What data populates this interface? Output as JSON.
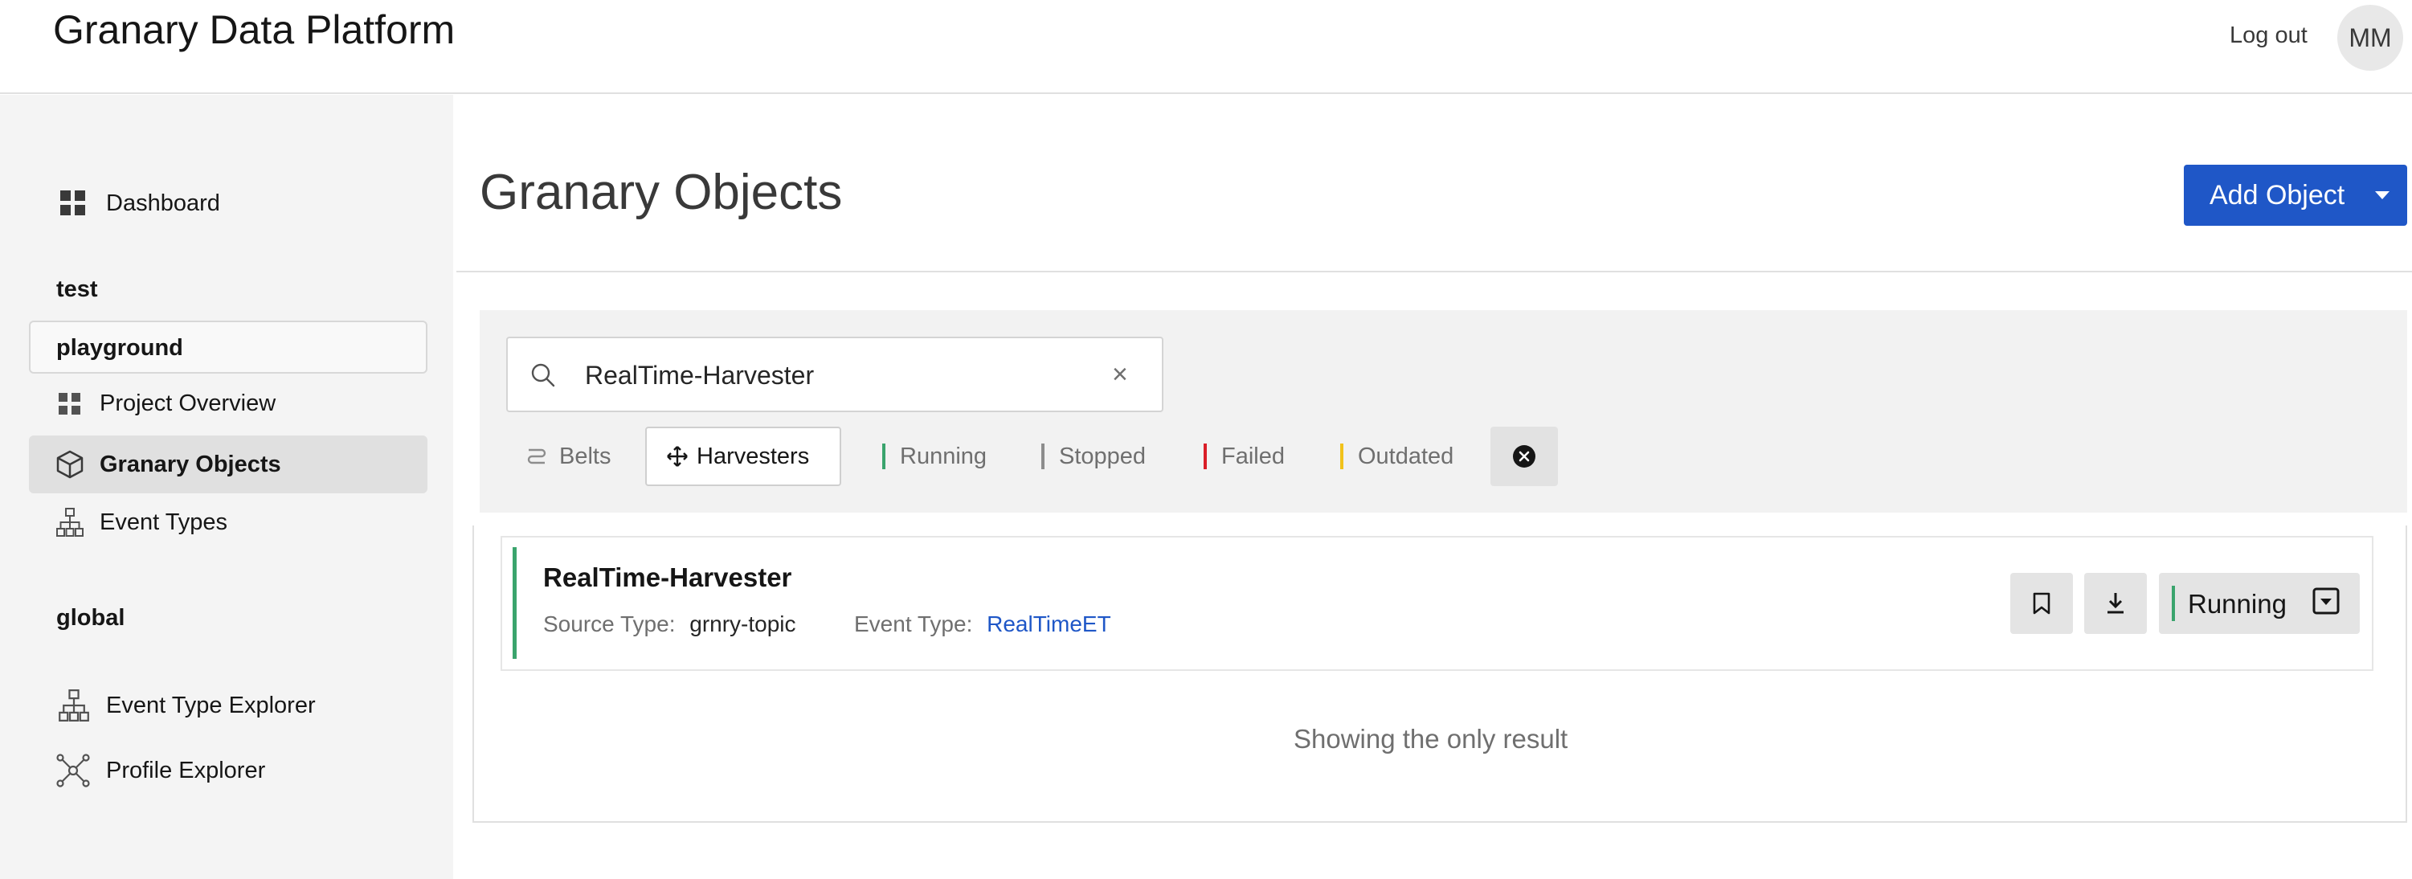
{
  "header": {
    "app_title": "Granary Data Platform",
    "logout_label": "Log out",
    "avatar_initials": "MM"
  },
  "sidebar": {
    "dashboard_label": "Dashboard",
    "test_heading": "test",
    "project_label": "playground",
    "items": [
      {
        "label": "Project Overview",
        "icon": "grid-icon"
      },
      {
        "label": "Granary Objects",
        "icon": "cube-icon",
        "active": true
      },
      {
        "label": "Event Types",
        "icon": "hierarchy-icon"
      }
    ],
    "global_heading": "global",
    "global_items": [
      {
        "label": "Event Type Explorer",
        "icon": "hierarchy-icon"
      },
      {
        "label": "Profile Explorer",
        "icon": "network-icon"
      }
    ]
  },
  "main": {
    "page_title": "Granary Objects",
    "add_button_label": "Add Object",
    "search": {
      "value": "RealTime-Harvester"
    },
    "filters": {
      "belts_label": "Belts",
      "harvesters_label": "Harvesters",
      "running_label": "Running",
      "stopped_label": "Stopped",
      "failed_label": "Failed",
      "outdated_label": "Outdated"
    },
    "result": {
      "name": "RealTime-Harvester",
      "source_type_key": "Source Type:",
      "source_type_value": "grnry-topic",
      "event_type_key": "Event Type:",
      "event_type_value": "RealTimeET",
      "status_label": "Running"
    },
    "result_count_text": "Showing the only result"
  },
  "colors": {
    "accent_blue": "#1f57c7",
    "running_green": "#3aa46d",
    "stopped_gray": "#8d8d8d",
    "failed_red": "#da1e28",
    "outdated_yellow": "#f1c21b"
  }
}
